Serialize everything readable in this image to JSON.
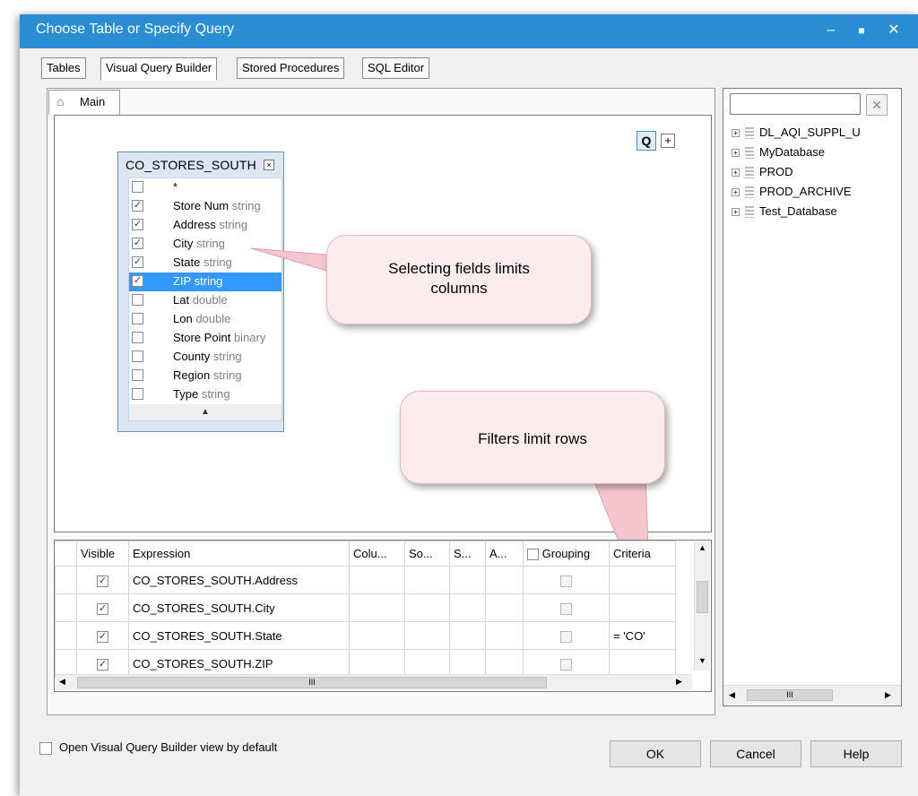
{
  "window": {
    "title": "Choose Table or Specify Query",
    "minimize": "–",
    "maximize": "■",
    "close": "✕"
  },
  "tabs": [
    "Tables",
    "Visual Query Builder",
    "Stored Procedures",
    "SQL Editor"
  ],
  "query_tab": {
    "label": "Main"
  },
  "toolbar": {
    "q_label": "Q",
    "plus_label": "+"
  },
  "table_box": {
    "title": "CO_STORES_SOUTH",
    "fields": [
      {
        "name": "*",
        "type": "",
        "checked": false
      },
      {
        "name": "Store Num",
        "type": "string",
        "checked": true
      },
      {
        "name": "Address",
        "type": "string",
        "checked": true
      },
      {
        "name": "City",
        "type": "string",
        "checked": true
      },
      {
        "name": "State",
        "type": "string",
        "checked": true
      },
      {
        "name": "ZIP",
        "type": "string",
        "checked": true,
        "selected": true
      },
      {
        "name": "Lat",
        "type": "double",
        "checked": false
      },
      {
        "name": "Lon",
        "type": "double",
        "checked": false
      },
      {
        "name": "Store Point",
        "type": "binary",
        "checked": false
      },
      {
        "name": "County",
        "type": "string",
        "checked": false
      },
      {
        "name": "Region",
        "type": "string",
        "checked": false
      },
      {
        "name": "Type",
        "type": "string",
        "checked": false
      }
    ]
  },
  "callouts": {
    "fields": "Selecting fields limits columns",
    "filters": "Filters limit rows"
  },
  "grid": {
    "headers": [
      "Visible",
      "Expression",
      "Colu...",
      "So...",
      "S...",
      "A...",
      "Grouping",
      "Criteria"
    ],
    "rows": [
      {
        "visible": true,
        "expression": "CO_STORES_SOUTH.Address",
        "criteria": ""
      },
      {
        "visible": true,
        "expression": "CO_STORES_SOUTH.City",
        "criteria": ""
      },
      {
        "visible": true,
        "expression": "CO_STORES_SOUTH.State",
        "criteria": "= 'CO'"
      },
      {
        "visible": true,
        "expression": "CO_STORES_SOUTH.ZIP",
        "criteria": ""
      }
    ],
    "hscroll_grip": "III"
  },
  "tree": {
    "clear_label": "✕",
    "items": [
      "DL_AQI_SUPPL_U",
      "MyDatabase",
      "PROD",
      "PROD_ARCHIVE",
      "Test_Database"
    ]
  },
  "footer": {
    "default_view_label": "Open Visual Query Builder view by default",
    "ok_label": "OK",
    "cancel_label": "Cancel",
    "help_label": "Help"
  }
}
